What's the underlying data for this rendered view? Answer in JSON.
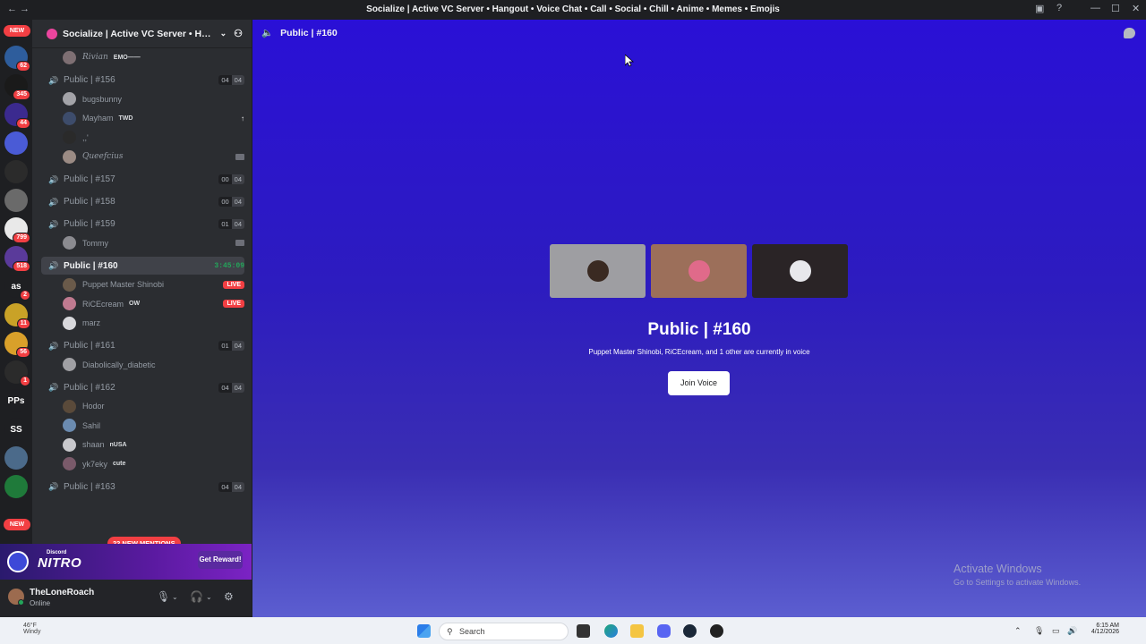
{
  "window": {
    "title": "Socialize | Active VC Server • Hangout • Voice Chat • Call • Social • Chill • Anime • Memes • Emojis"
  },
  "servers": {
    "new_top": "NEW",
    "new_bottom": "NEW",
    "items": [
      {
        "label": "",
        "badge": "62",
        "color": "#2e5d9c"
      },
      {
        "label": "",
        "badge": "345",
        "color": "#1a1a1a"
      },
      {
        "label": "",
        "badge": "44",
        "color": "#3b2a8f"
      },
      {
        "label": "",
        "badge": "",
        "color": "#4a5bd6"
      },
      {
        "label": "",
        "badge": "",
        "color": "#2b2b2b"
      },
      {
        "label": "",
        "badge": "",
        "color": "#6a6a6a"
      },
      {
        "label": "",
        "badge": "799",
        "color": "#e9e9e9"
      },
      {
        "label": "",
        "badge": "518",
        "color": "#5a3a9a"
      },
      {
        "label": "as",
        "badge": "2",
        "color": "#1e1f22"
      },
      {
        "label": "",
        "badge": "11",
        "color": "#c9a227"
      },
      {
        "label": "",
        "badge": "56",
        "color": "#d9a02a"
      },
      {
        "label": "",
        "badge": "1",
        "color": "#2b2b2b"
      },
      {
        "label": "PPs",
        "badge": "",
        "color": "#1e1f22"
      },
      {
        "label": "SS",
        "badge": "",
        "color": "#1e1f22"
      },
      {
        "label": "",
        "badge": "",
        "color": "#4b6a8a"
      },
      {
        "label": "",
        "badge": "",
        "color": "#1f7a3a"
      }
    ]
  },
  "sidebar": {
    "server_name": "Socialize | Active VC Server • Han...",
    "mentions_pill": "22 NEW MENTIONS",
    "rows": [
      {
        "kind": "user",
        "name": "Rivian",
        "tag": "EMO——",
        "italic": true
      },
      {
        "kind": "channel",
        "name": "Public | #156",
        "c1": "04",
        "c2": "04",
        "on": true
      },
      {
        "kind": "user",
        "name": "bugsbunny"
      },
      {
        "kind": "user",
        "name": "Mayham",
        "tag": "TWD",
        "right": "↑"
      },
      {
        "kind": "user",
        "name": ",,'"
      },
      {
        "kind": "user",
        "name": "Queefcius",
        "italic": true,
        "right": "cam"
      },
      {
        "kind": "channel",
        "name": "Public | #157",
        "c1": "00",
        "c2": "04"
      },
      {
        "kind": "channel",
        "name": "Public | #158",
        "c1": "00",
        "c2": "04"
      },
      {
        "kind": "channel",
        "name": "Public | #159",
        "c1": "01",
        "c2": "04",
        "on": true
      },
      {
        "kind": "user",
        "name": "Tommy",
        "right": "cam"
      },
      {
        "kind": "channel",
        "name": "Public | #160",
        "time": "3:45:09",
        "active": true,
        "on": true
      },
      {
        "kind": "user",
        "name": "Puppet Master Shinobi",
        "right": "LIVE"
      },
      {
        "kind": "user",
        "name": "RiCEcream",
        "tag": "OW",
        "right": "LIVE"
      },
      {
        "kind": "user",
        "name": "marz"
      },
      {
        "kind": "channel",
        "name": "Public | #161",
        "c1": "01",
        "c2": "04",
        "on": true
      },
      {
        "kind": "user",
        "name": "Diabolically_diabetic"
      },
      {
        "kind": "channel",
        "name": "Public | #162",
        "c1": "04",
        "c2": "04",
        "on": true
      },
      {
        "kind": "user",
        "name": "Hodor"
      },
      {
        "kind": "user",
        "name": "Sahil"
      },
      {
        "kind": "user",
        "name": "shaan",
        "tag": "nUSA"
      },
      {
        "kind": "user",
        "name": "yk7eky",
        "tag": "cute"
      },
      {
        "kind": "channel",
        "name": "Public | #163",
        "c1": "04",
        "c2": "04",
        "on": true
      }
    ]
  },
  "nitro": {
    "small": "Discord",
    "word": "NITRO",
    "button": "Get Reward!"
  },
  "user": {
    "name": "TheLoneRoach",
    "status": "Online"
  },
  "main": {
    "channel": "Public | #160",
    "title": "Public | #160",
    "subtitle": "Puppet Master Shinobi, RiCEcream, and 1 other are currently in voice",
    "join": "Join Voice",
    "tiles": [
      {
        "bg": "#9e9ea2",
        "av": "#3a2a22"
      },
      {
        "bg": "#9c6f5a",
        "av": "#e06a8a"
      },
      {
        "bg": "#2a2426",
        "av": "#e8e8ec"
      }
    ]
  },
  "watermark": {
    "line1": "Activate Windows",
    "line2": "Go to Settings to activate Windows."
  },
  "taskbar": {
    "temp": "46°F",
    "weather": "Windy",
    "search": "Search",
    "time": "6:15 AM",
    "date": "4/12/2026"
  }
}
